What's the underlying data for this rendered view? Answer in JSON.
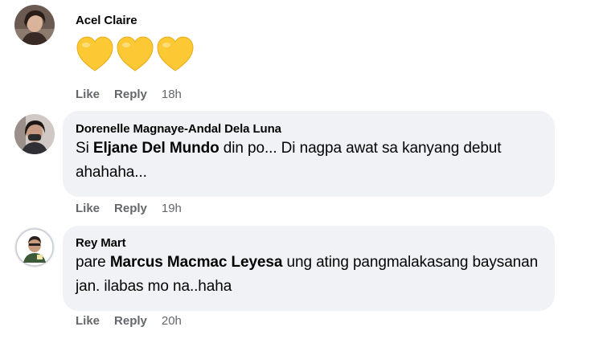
{
  "comments": [
    {
      "author": "Acel Claire",
      "reaction_icons": [
        "yellow-heart-icon",
        "yellow-heart-icon",
        "yellow-heart-icon"
      ],
      "actions": {
        "like": "Like",
        "reply": "Reply",
        "time": "18h"
      }
    },
    {
      "author": "Dorenelle Magnaye-Andal Dela Luna",
      "text_before": "Si ",
      "mention": "Eljane Del Mundo",
      "text_after": " din po... Di nagpa awat sa kanyang debut ahahaha...",
      "actions": {
        "like": "Like",
        "reply": "Reply",
        "time": "19h"
      }
    },
    {
      "author": "Rey Mart",
      "text_before": "pare ",
      "mention": "Marcus Macmac Leyesa",
      "text_after": " ung ating pangmalakasang baysanan jan. ilabas mo na..haha",
      "actions": {
        "like": "Like",
        "reply": "Reply",
        "time": "20h"
      }
    }
  ],
  "colors": {
    "bubble": "#f0f2f5",
    "meta_text": "#65676b",
    "heart": "#fcc934"
  }
}
